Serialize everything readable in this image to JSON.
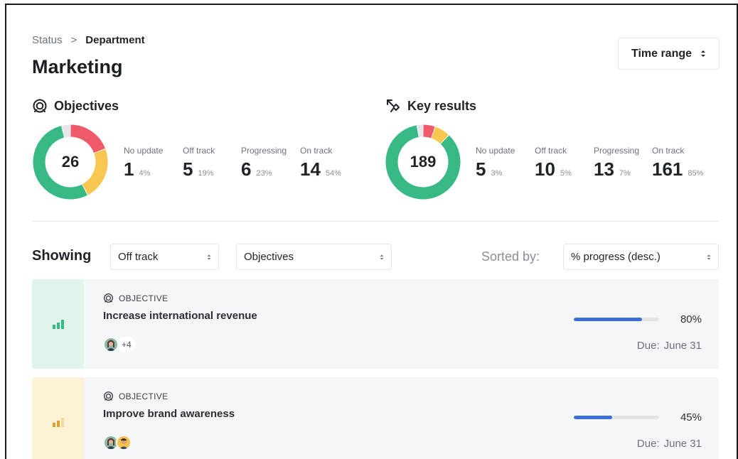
{
  "breadcrumb": {
    "parent": "Status",
    "separator": ">",
    "current": "Department"
  },
  "page_title": "Marketing",
  "time_range": {
    "label": "Time range"
  },
  "objectives": {
    "heading": "Objectives",
    "total": "26",
    "stats": [
      {
        "label": "No update",
        "value": "1",
        "pct": "4%"
      },
      {
        "label": "Off track",
        "value": "5",
        "pct": "19%"
      },
      {
        "label": "Progressing",
        "value": "6",
        "pct": "23%"
      },
      {
        "label": "On track",
        "value": "14",
        "pct": "54%"
      }
    ]
  },
  "key_results": {
    "heading": "Key results",
    "total": "189",
    "stats": [
      {
        "label": "No update",
        "value": "5",
        "pct": "3%"
      },
      {
        "label": "Off track",
        "value": "10",
        "pct": "5%"
      },
      {
        "label": "Progressing",
        "value": "13",
        "pct": "7%"
      },
      {
        "label": "On track",
        "value": "161",
        "pct": "85%"
      }
    ]
  },
  "colors": {
    "no_update": "#e4e6e9",
    "off_track": "#ef5a6a",
    "progressing": "#f9c74f",
    "on_track": "#37b985",
    "progress_bar": "#3a6fd8"
  },
  "filters": {
    "showing_label": "Showing",
    "status_select": "Off track",
    "type_select": "Objectives",
    "sorted_label": "Sorted by:",
    "sort_select": "% progress (desc.)"
  },
  "cards": [
    {
      "type_label": "OBJECTIVE",
      "title": "Increase international revenue",
      "extra_members": "+4",
      "progress": 80,
      "progress_text": "80%",
      "due_label": "Due:",
      "due_date": "June 31"
    },
    {
      "type_label": "OBJECTIVE",
      "title": "Improve brand awareness",
      "extra_members": "",
      "progress": 45,
      "progress_text": "45%",
      "due_label": "Due:",
      "due_date": "June 31"
    }
  ]
}
